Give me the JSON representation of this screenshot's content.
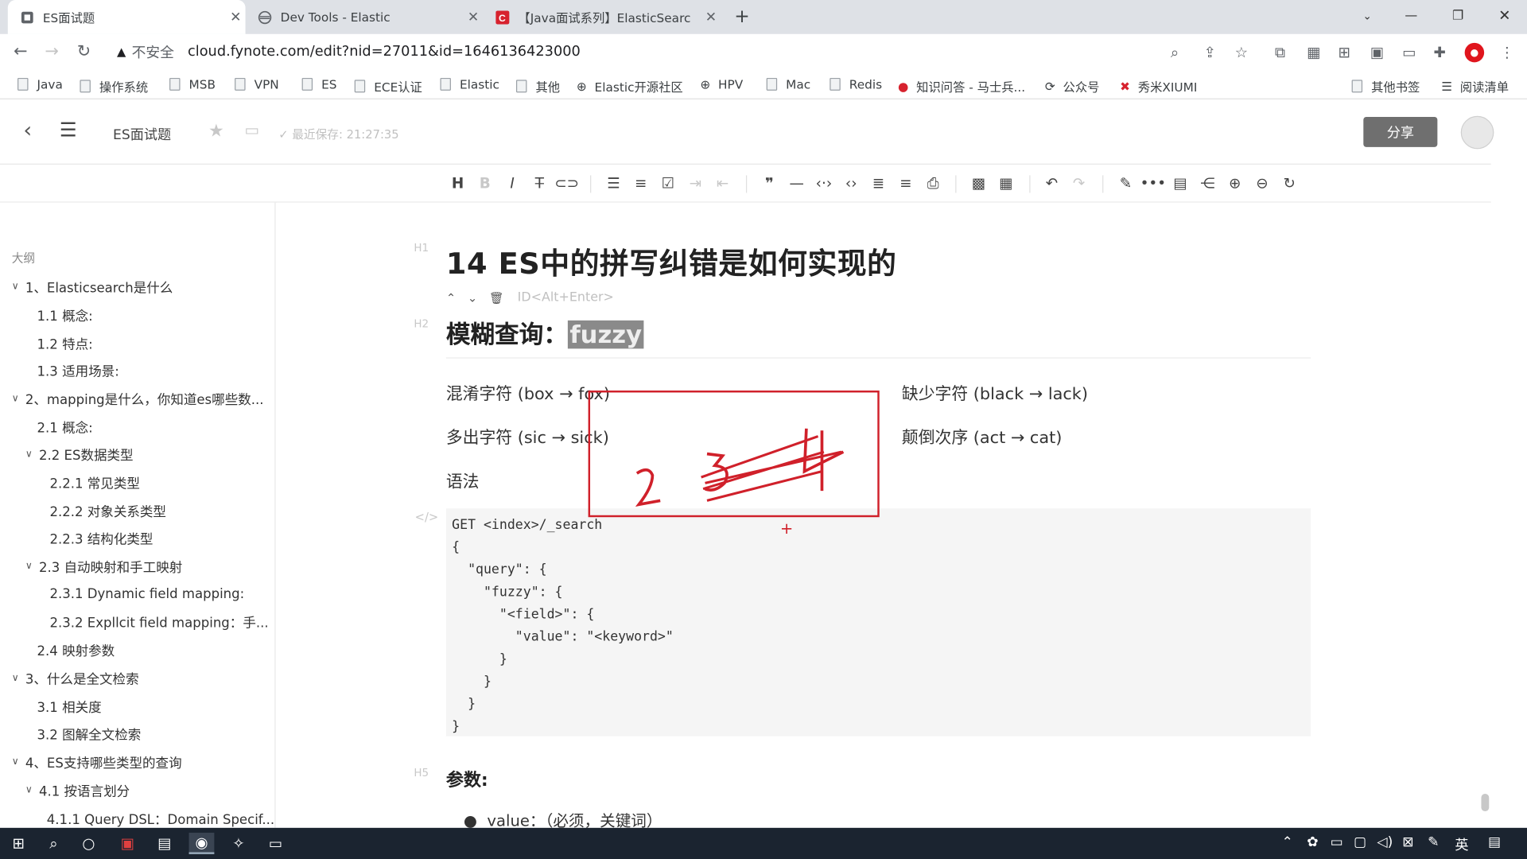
{
  "browser": {
    "tabs": [
      {
        "title": "ES面试题",
        "icon": "doc-icon"
      },
      {
        "title": "Dev Tools - Elastic",
        "icon": "elastic-icon"
      },
      {
        "title": "【Java面试系列】ElasticSearc",
        "icon": "csdn-icon"
      }
    ],
    "url_warning": "不安全",
    "url": "cloud.fynote.com/edit?nid=27011&id=1646136423000",
    "bookmarks": [
      "Java",
      "操作系统",
      "MSB",
      "VPN",
      "ES",
      "ECE认证",
      "Elastic",
      "其他",
      "Elastic开源社区",
      "HPV",
      "Mac",
      "Redis",
      "知识问答 - 马士兵...",
      "公众号",
      "秀米XIUMI",
      "其他书签",
      "阅读清单"
    ]
  },
  "app": {
    "doc_title": "ES面试题",
    "saved_text": "最近保存: 21:27:35",
    "share_label": "分享"
  },
  "sidebar": {
    "title": "大纲",
    "items": [
      {
        "label": "1、Elasticsearch是什么",
        "caret": true
      },
      {
        "label": "1.1 概念:",
        "caret": false
      },
      {
        "label": "1.2 特点:",
        "caret": false
      },
      {
        "label": "1.3 适用场景:",
        "caret": false
      },
      {
        "label": "2、mapping是什么，你知道es哪些数...",
        "caret": true
      },
      {
        "label": "2.1 概念:",
        "caret": false
      },
      {
        "label": "2.2 ES数据类型",
        "caret": true
      },
      {
        "label": "2.2.1 常见类型",
        "caret": false
      },
      {
        "label": "2.2.2 对象关系类型",
        "caret": false
      },
      {
        "label": "2.2.3 结构化类型",
        "caret": false
      },
      {
        "label": "2.3 自动映射和手工映射",
        "caret": true
      },
      {
        "label": "2.3.1 Dynamic field mapping:",
        "caret": false
      },
      {
        "label": "2.3.2 Expllcit field mapping：手...",
        "caret": false
      },
      {
        "label": "2.4 映射参数",
        "caret": false
      },
      {
        "label": "3、什么是全文检索",
        "caret": true
      },
      {
        "label": "3.1 相关度",
        "caret": false
      },
      {
        "label": "3.2 图解全文检索",
        "caret": false
      },
      {
        "label": "4、ES支持哪些类型的查询",
        "caret": true
      },
      {
        "label": "4.1 按语言划分",
        "caret": true
      },
      {
        "label": "4.1.1 Query DSL：Domain Specif...",
        "caret": false
      }
    ]
  },
  "editor": {
    "h1_label": "H1",
    "h2_label": "H2",
    "h5_label": "H5",
    "code_label": "</>",
    "h1": "14 ES中的拼写纠错是如何实现的",
    "block_id_placeholder": "ID<Alt+Enter>",
    "h2_prefix": "模糊查询：",
    "h2_mark": "fuzzy",
    "cases": {
      "confuse": "混淆字符 (box → fox)",
      "missing": "缺少字符 (black → lack)",
      "extra": "多出字符 (sic → sick)",
      "swap": "颠倒次序 (act → cat)"
    },
    "syntax_label": "语法",
    "code": "GET <index>/_search\n{\n  \"query\": {\n    \"fuzzy\": {\n      \"<field>\": {\n        \"value\": \"<keyword>\"\n      }\n    }\n  }\n}",
    "params_heading": "参数:",
    "param_bullet": "value：（必须，关键词）"
  },
  "annotation": {
    "handwriting": "2  3  4",
    "color": "#d0202a"
  }
}
